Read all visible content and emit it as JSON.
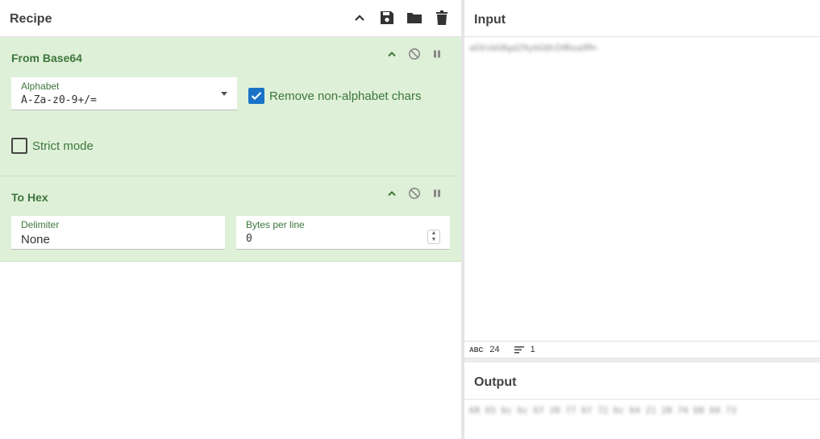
{
  "recipe": {
    "title": "Recipe",
    "header_icons": [
      "chevron-up-icon",
      "save-icon",
      "folder-icon",
      "trash-icon"
    ]
  },
  "operations": [
    {
      "title": "From Base64",
      "alphabet_label": "Alphabet",
      "alphabet_value": "A-Za-z0-9+/=",
      "remove_nonalpha_label": "Remove non-alphabet chars",
      "remove_nonalpha_checked": true,
      "strict_mode_label": "Strict mode",
      "strict_mode_checked": false
    },
    {
      "title": "To Hex",
      "delimiter_label": "Delimiter",
      "delimiter_value": "None",
      "bytes_per_line_label": "Bytes per line",
      "bytes_per_line_value": "0"
    }
  ],
  "input": {
    "title": "Input",
    "text": "aGVsbG8gd29ybGQhIHRoaXM=",
    "char_count": "24",
    "line_count": "1"
  },
  "output": {
    "title": "Output",
    "text": "68 65 6c 6c 6f 20 77 6f 72 6c 64 21 20 74 68 69 73"
  },
  "colors": {
    "operation_bg": "#dff0d8",
    "operation_text": "#3c763d",
    "checkbox_checked": "#1a73c8"
  }
}
